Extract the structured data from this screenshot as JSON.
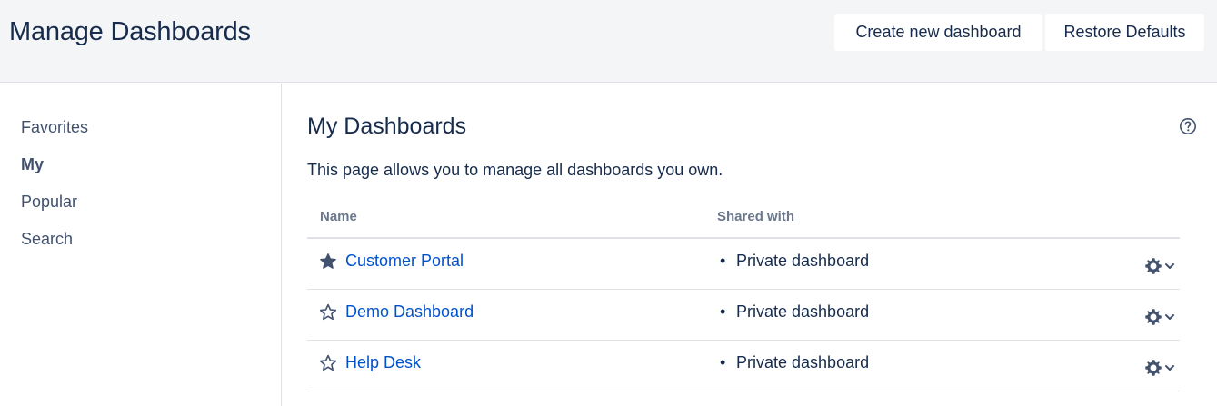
{
  "header": {
    "title": "Manage Dashboards",
    "create_label": "Create new dashboard",
    "restore_label": "Restore Defaults"
  },
  "sidebar": {
    "items": [
      {
        "label": "Favorites",
        "active": false
      },
      {
        "label": "My",
        "active": true
      },
      {
        "label": "Popular",
        "active": false
      },
      {
        "label": "Search",
        "active": false
      }
    ]
  },
  "main": {
    "title": "My Dashboards",
    "description": "This page allows you to manage all dashboards you own.",
    "help_icon": "question-circle-icon",
    "table": {
      "columns": [
        "Name",
        "Shared with"
      ],
      "rows": [
        {
          "name": "Customer Portal",
          "favorite": true,
          "shared": "Private dashboard"
        },
        {
          "name": "Demo Dashboard",
          "favorite": false,
          "shared": "Private dashboard"
        },
        {
          "name": "Help Desk",
          "favorite": false,
          "shared": "Private dashboard"
        }
      ]
    }
  },
  "colors": {
    "header_bg": "#f4f5f7",
    "link": "#0052cc",
    "text": "#172b4d",
    "muted": "#6b778c",
    "border": "#dfe1e6"
  }
}
